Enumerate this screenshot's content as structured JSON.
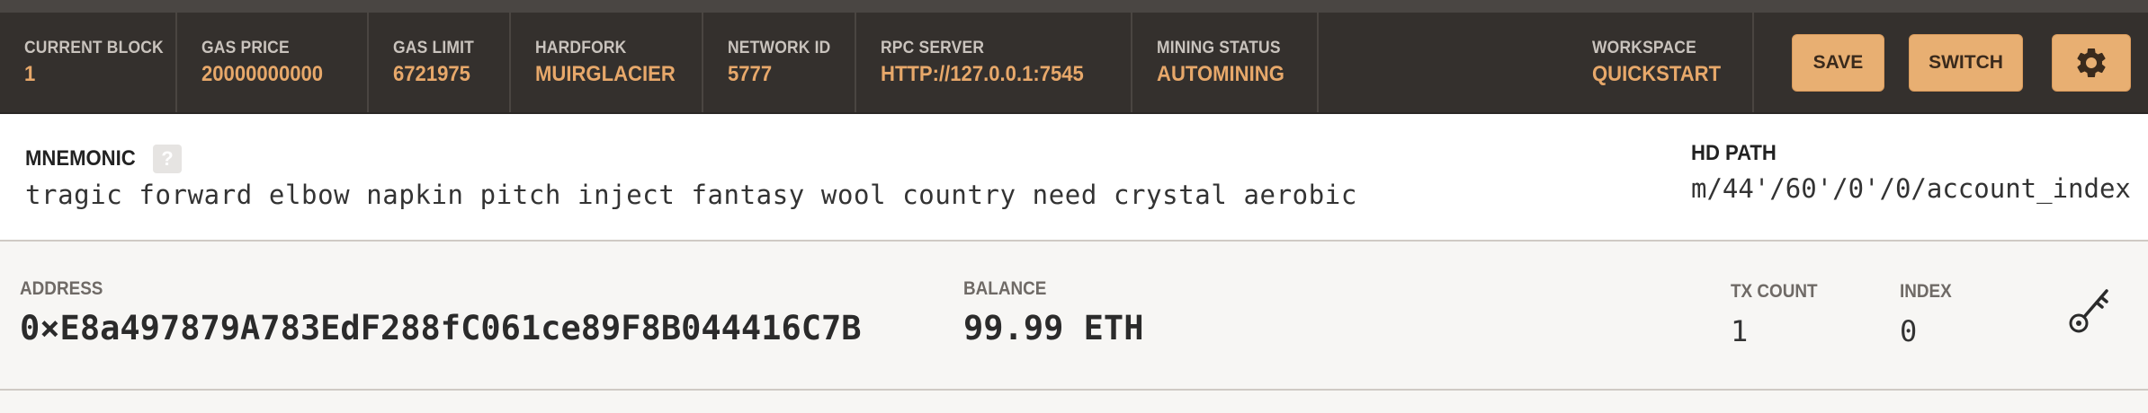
{
  "header": {
    "stats": [
      {
        "label": "CURRENT BLOCK",
        "value": "1"
      },
      {
        "label": "GAS PRICE",
        "value": "20000000000"
      },
      {
        "label": "GAS LIMIT",
        "value": "6721975"
      },
      {
        "label": "HARDFORK",
        "value": "MUIRGLACIER"
      },
      {
        "label": "NETWORK ID",
        "value": "5777"
      },
      {
        "label": "RPC SERVER",
        "value": "HTTP://127.0.0.1:7545"
      },
      {
        "label": "MINING STATUS",
        "value": "AUTOMINING"
      }
    ],
    "workspace": {
      "label": "WORKSPACE",
      "value": "QUICKSTART"
    },
    "save_label": "SAVE",
    "switch_label": "SWITCH",
    "settings_icon": "gear-icon"
  },
  "mnemonic": {
    "label": "MNEMONIC",
    "help": "?",
    "words": "tragic forward elbow napkin pitch inject fantasy wool country need crystal aerobic",
    "hd_path_label": "HD PATH",
    "hd_path": "m/44'/60'/0'/0/account_index"
  },
  "account": {
    "address_label": "ADDRESS",
    "address": "0×E8a497879A783EdF288fC061ce89F8B044416C7B",
    "balance_label": "BALANCE",
    "balance": "99.99 ETH",
    "tx_count_label": "TX COUNT",
    "tx_count": "1",
    "index_label": "INDEX",
    "index": "0",
    "key_icon": "key-icon"
  },
  "colors": {
    "accent": "#e7a86a",
    "header_bg": "#34302d",
    "button_bg": "#e8af72"
  }
}
